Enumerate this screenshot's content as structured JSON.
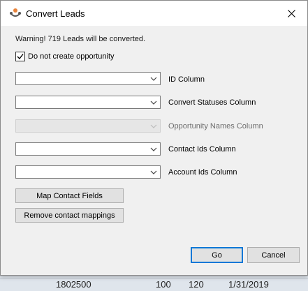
{
  "background": {
    "cells": [
      "1802500",
      "100",
      "120",
      "1/31/2019"
    ]
  },
  "dialog": {
    "title": "Convert Leads",
    "warning": "Warning! 719 Leads will be converted.",
    "checkbox": {
      "label": "Do not create opportunity",
      "checked": true
    },
    "fields": [
      {
        "label": "ID Column",
        "value": "",
        "enabled": true
      },
      {
        "label": "Convert Statuses Column",
        "value": "",
        "enabled": true
      },
      {
        "label": "Opportunity Names Column",
        "value": "",
        "enabled": false
      },
      {
        "label": "Contact Ids Column",
        "value": "",
        "enabled": true
      },
      {
        "label": "Account Ids Column",
        "value": "",
        "enabled": true
      }
    ],
    "buttons": {
      "map_contact": "Map Contact Fields",
      "remove_mappings": "Remove contact mappings",
      "go": "Go",
      "cancel": "Cancel"
    }
  },
  "colors": {
    "accent": "#0078d7",
    "icon_orange": "#e8833a"
  },
  "icons": {
    "app": "app-logo-icon",
    "close": "close-icon",
    "dropdown": "chevron-down-icon",
    "check": "check-icon"
  }
}
